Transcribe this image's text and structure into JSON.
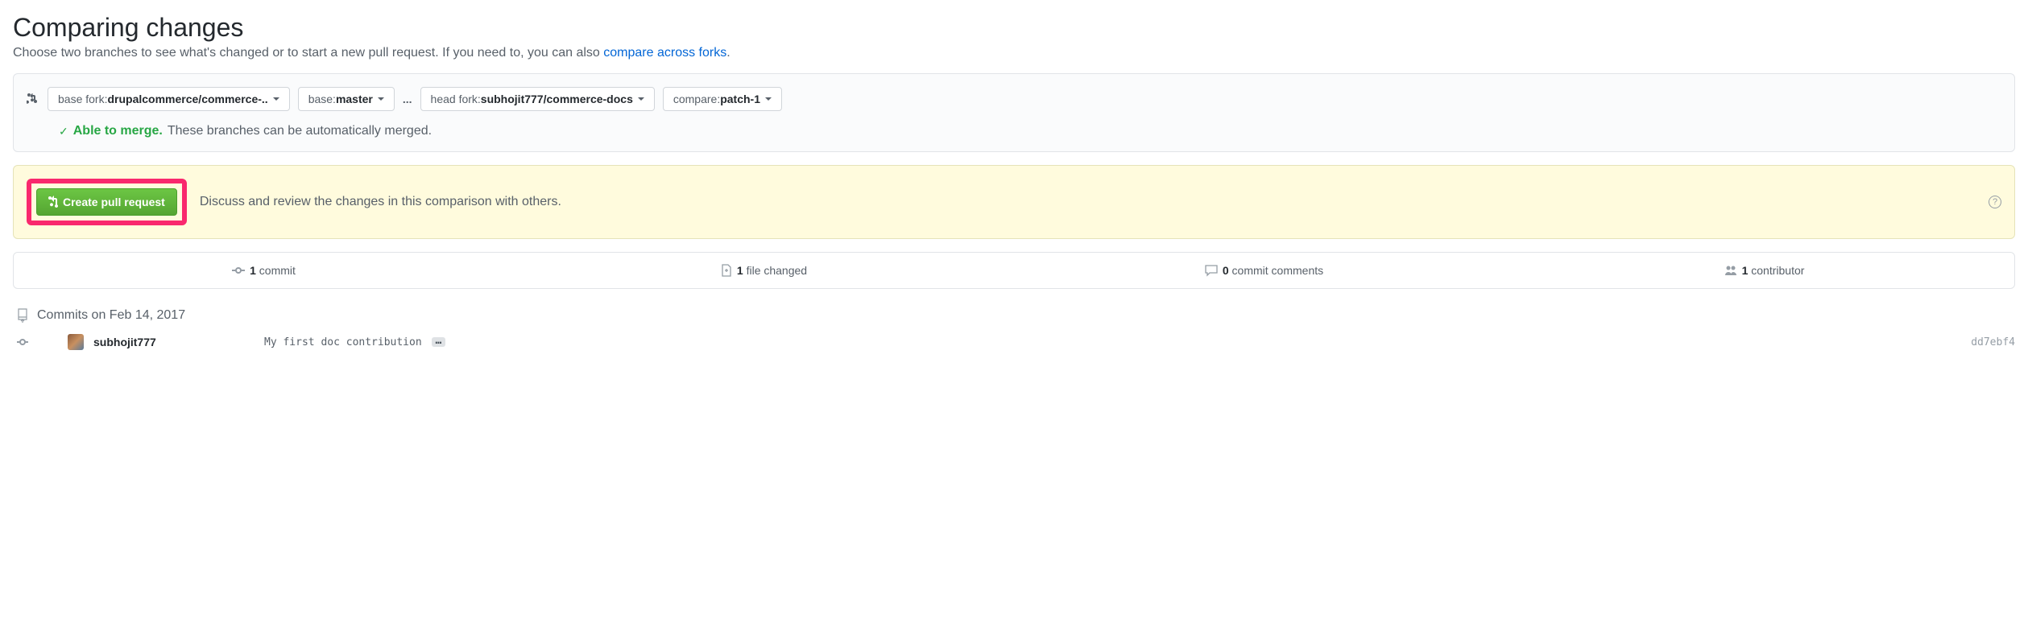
{
  "header": {
    "title": "Comparing changes",
    "subtitle_prefix": "Choose two branches to see what's changed or to start a new pull request. If you need to, you can also ",
    "subtitle_link": "compare across forks",
    "subtitle_suffix": "."
  },
  "compare": {
    "base_fork_label": "base fork: ",
    "base_fork_value": "drupalcommerce/commerce-..",
    "base_label": "base: ",
    "base_value": "master",
    "dots": "...",
    "head_fork_label": "head fork: ",
    "head_fork_value": "subhojit777/commerce-docs",
    "compare_label": "compare: ",
    "compare_value": "patch-1",
    "merge_checkmark": "✓",
    "merge_status": "Able to merge.",
    "merge_desc": "These branches can be automatically merged."
  },
  "create_pr": {
    "button_label": "Create pull request",
    "discuss_text": "Discuss and review the changes in this comparison with others.",
    "help": "?"
  },
  "stats": {
    "commits_count": "1",
    "commits_label": " commit",
    "files_count": "1",
    "files_label": " file changed",
    "comments_count": "0",
    "comments_label": " commit comments",
    "contributors_count": "1",
    "contributors_label": " contributor"
  },
  "commits": {
    "date_header": "Commits on Feb 14, 2017",
    "items": [
      {
        "user": "subhojit777",
        "message": "My first doc contribution",
        "ellipsis": "…",
        "hash": "dd7ebf4"
      }
    ]
  }
}
